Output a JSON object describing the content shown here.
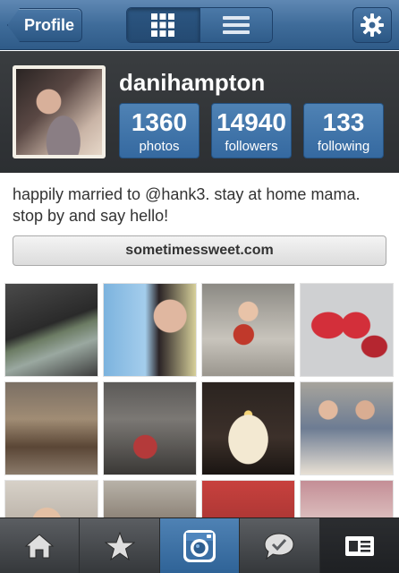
{
  "nav": {
    "back_label": "Profile"
  },
  "profile": {
    "username": "danihampton",
    "stats": [
      {
        "value": "1360",
        "label": "photos"
      },
      {
        "value": "14940",
        "label": "followers"
      },
      {
        "value": "133",
        "label": "following"
      }
    ],
    "bio": "happily married to @hank3. stay at home mama. stop by and say hello!",
    "website": "sometimessweet.com"
  },
  "photos": [
    {
      "desc": "gym-treadmill"
    },
    {
      "desc": "selfie-sunglasses"
    },
    {
      "desc": "baby-shopping-cart"
    },
    {
      "desc": "red-shoes"
    },
    {
      "desc": "kitchen-highchair"
    },
    {
      "desc": "kid-on-couch"
    },
    {
      "desc": "birthday-cake"
    },
    {
      "desc": "couple-at-table"
    },
    {
      "desc": "woman-portrait"
    },
    {
      "desc": "dining-room"
    },
    {
      "desc": "red-chairs"
    },
    {
      "desc": "store-interior"
    }
  ],
  "tabs": [
    {
      "icon": "home-icon"
    },
    {
      "icon": "star-icon"
    },
    {
      "icon": "camera-icon"
    },
    {
      "icon": "speech-bubble-icon"
    },
    {
      "icon": "profile-card-icon"
    }
  ],
  "colors": {
    "nav_blue": "#3f6c9a",
    "stat_blue": "#3569a0",
    "header_dark": "#2c2f32"
  }
}
